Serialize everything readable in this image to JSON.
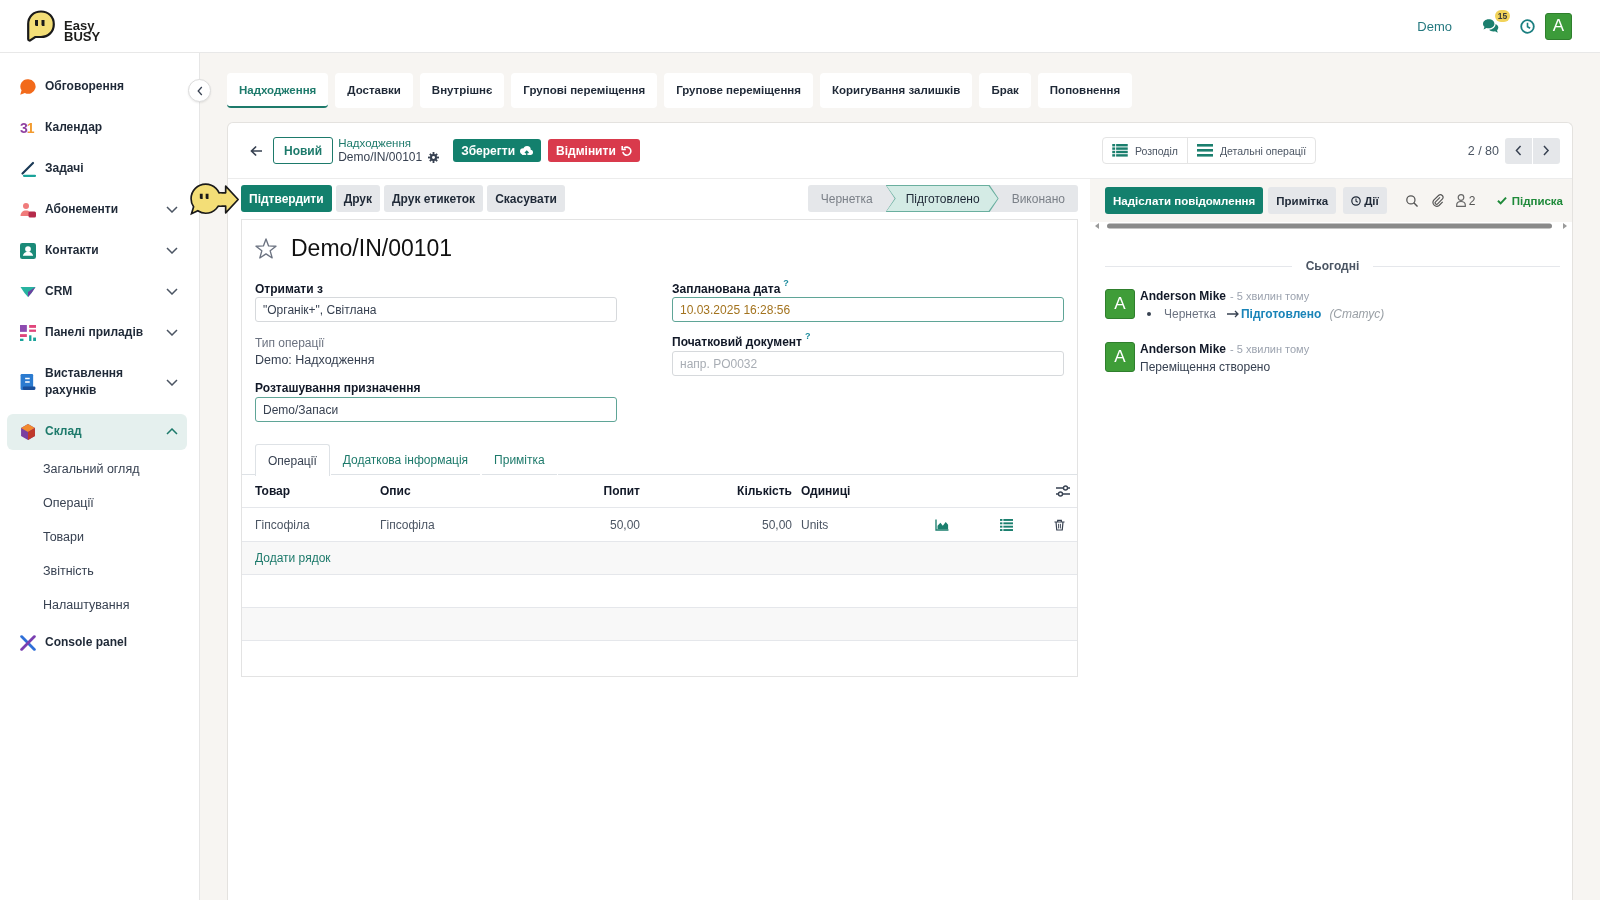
{
  "header": {
    "logo": {
      "lines": [
        "Easy",
        "BUSY"
      ]
    },
    "company": "Demo",
    "messages_badge": "15",
    "user_avatar": "A"
  },
  "sidebar": {
    "items": [
      {
        "label": "Обговорення",
        "kind": "link",
        "selected": false
      },
      {
        "label": "Календар",
        "kind": "link",
        "selected": false,
        "glyph": "31"
      },
      {
        "label": "Задачі",
        "kind": "link",
        "selected": false
      },
      {
        "label": "Абонементи",
        "kind": "group",
        "selected": false,
        "expanded": false
      },
      {
        "label": "Контакти",
        "kind": "group",
        "selected": false,
        "expanded": false
      },
      {
        "label": "CRM",
        "kind": "group",
        "selected": false,
        "expanded": false
      },
      {
        "label": "Панелі приладів",
        "kind": "group",
        "selected": false,
        "expanded": false
      },
      {
        "label": "Виставлення рахунків",
        "kind": "group",
        "selected": false,
        "expanded": false
      },
      {
        "label": "Склад",
        "kind": "group",
        "selected": true,
        "expanded": true,
        "children": [
          {
            "label": "Загальний огляд",
            "selected": false
          },
          {
            "label": "Операції",
            "selected": false
          },
          {
            "label": "Товари",
            "selected": false
          },
          {
            "label": "Звітність",
            "selected": false
          },
          {
            "label": "Налаштування",
            "selected": false
          }
        ]
      },
      {
        "label": "Console panel",
        "kind": "link",
        "selected": false
      }
    ]
  },
  "tabs": [
    {
      "label": "Надходження",
      "selected": true
    },
    {
      "label": "Доставки",
      "selected": false
    },
    {
      "label": "Внутрішнє",
      "selected": false
    },
    {
      "label": "Групові переміщення",
      "selected": false
    },
    {
      "label": "Групове переміщення",
      "selected": false
    },
    {
      "label": "Коригування залишків",
      "selected": false
    },
    {
      "label": "Брак",
      "selected": false
    },
    {
      "label": "Поповнення",
      "selected": false
    }
  ],
  "control_panel": {
    "new_button": "Новий",
    "breadcrumb": {
      "parent": "Надходження",
      "current": "Demo/IN/00101"
    },
    "save_button": "Зберегти",
    "discard_button": "Відмінити",
    "view_buttons": [
      "Розподіл",
      "Детальні операції"
    ],
    "pager": "2 / 80"
  },
  "status_bar": {
    "actions": [
      {
        "label": "Підтвердити",
        "kind": "primary"
      },
      {
        "label": "Друк",
        "kind": "secondary"
      },
      {
        "label": "Друк етикеток",
        "kind": "secondary"
      },
      {
        "label": "Скасувати",
        "kind": "secondary"
      }
    ],
    "stages": [
      {
        "label": "Чернетка",
        "selected": false
      },
      {
        "label": "Підготовлено",
        "selected": true
      },
      {
        "label": "Виконано",
        "selected": false
      }
    ]
  },
  "sheet": {
    "title": "Demo/IN/00101",
    "starred": false,
    "fields_left": [
      {
        "kind": "input",
        "label": "Отримати з",
        "value": "\"Органік+\", Світлана",
        "required": false,
        "warning": false
      },
      {
        "kind": "readonly",
        "label": "Тип операції",
        "value": "Demo: Надходження"
      },
      {
        "kind": "input",
        "label": "Розташування призначення",
        "value": "Demo/Запаси",
        "required": true,
        "warning": false
      }
    ],
    "fields_right": [
      {
        "kind": "input",
        "label": "Запланована дата",
        "help": "?",
        "value": "10.03.2025 16:28:56",
        "required": true,
        "warning": true
      },
      {
        "kind": "input",
        "label": "Початковий документ",
        "help": "?",
        "placeholder": "напр. PO0032",
        "required": false
      }
    ],
    "notebook_tabs": [
      {
        "label": "Операції",
        "selected": true
      },
      {
        "label": "Додаткова інформація",
        "selected": false
      },
      {
        "label": "Примітка",
        "selected": false
      }
    ],
    "table": {
      "columns": [
        {
          "label": "Товар",
          "kind": "text"
        },
        {
          "label": "Опис",
          "kind": "text"
        },
        {
          "label": "Попит",
          "kind": "number"
        },
        {
          "label": "Кількість",
          "kind": "number"
        },
        {
          "label": "Одиниці",
          "kind": "text"
        }
      ],
      "rows": [
        {
          "cells": [
            "Гіпсофіла",
            "Гіпсофіла",
            "50,00",
            "50,00",
            "Units"
          ]
        }
      ],
      "add_line": "Додати рядок"
    }
  },
  "chatter": {
    "buttons": [
      {
        "label": "Надіслати повідомлення",
        "kind": "primary"
      },
      {
        "label": "Примітка",
        "kind": "secondary"
      },
      {
        "label": "Дії",
        "kind": "activity"
      }
    ],
    "followers": "2",
    "subscription": {
      "label": "Підписка",
      "following": true
    },
    "date_separator": "Сьогодні",
    "messages": [
      {
        "kind": "tracking",
        "avatar": "A",
        "author": "Anderson Mike",
        "time": "- 5 хвилин тому",
        "old_value": "Чернетка",
        "new_value": "Підготовлено",
        "field": "(Статус)"
      },
      {
        "kind": "note",
        "avatar": "A",
        "author": "Anderson Mike",
        "time": "- 5 хвилин тому",
        "body": "Переміщення створено"
      }
    ]
  }
}
